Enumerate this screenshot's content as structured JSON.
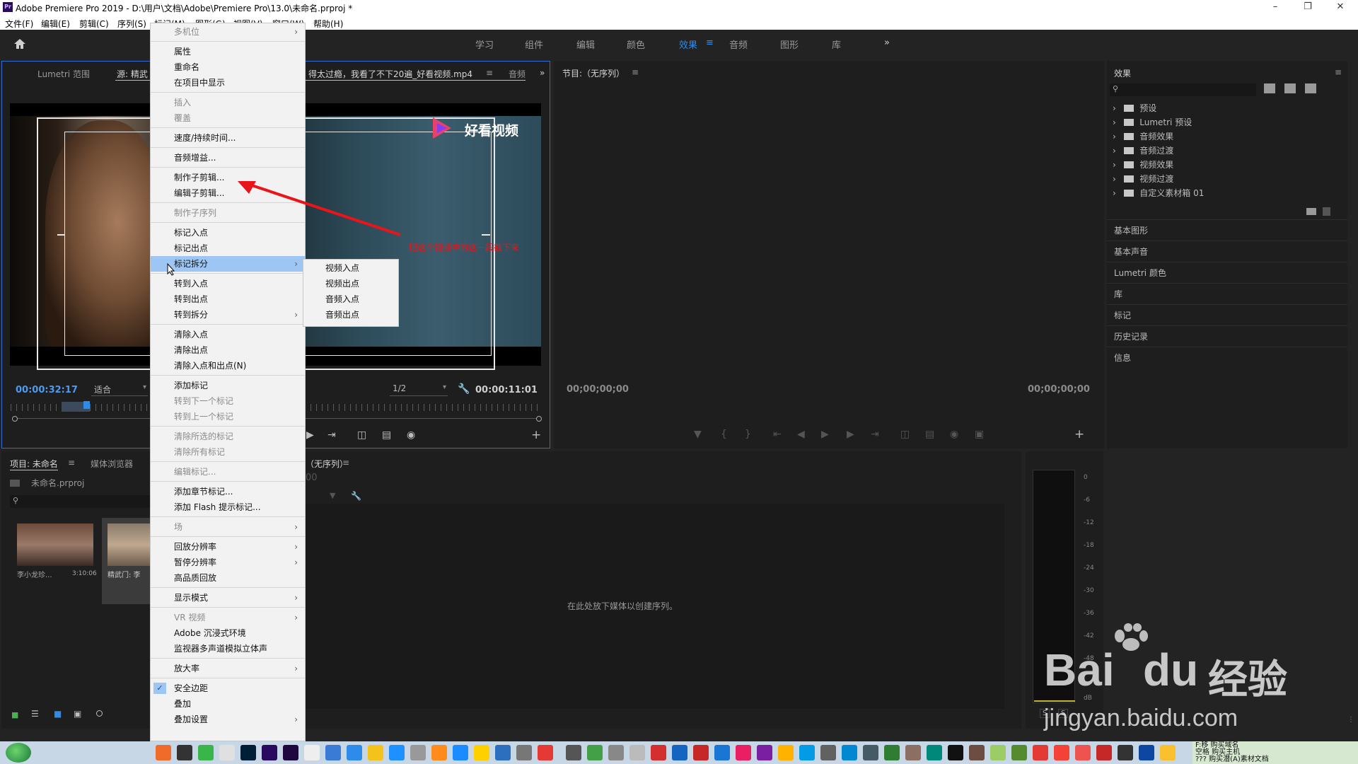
{
  "window": {
    "title": "Adobe Premiere Pro 2019 - D:\\用户\\文档\\Adobe\\Premiere Pro\\13.0\\未命名.prproj *",
    "app_icon": "Pr"
  },
  "menubar": [
    "文件(F)",
    "编辑(E)",
    "剪辑(C)",
    "序列(S)",
    "标记(M)",
    "图形(G)",
    "视图(V)",
    "窗口(W)",
    "帮助(H)"
  ],
  "workspaces": [
    {
      "label": "学习"
    },
    {
      "label": "组件"
    },
    {
      "label": "编辑"
    },
    {
      "label": "颜色"
    },
    {
      "label": "效果",
      "active": true
    },
    {
      "label": "音频"
    },
    {
      "label": "图形"
    },
    {
      "label": "库"
    }
  ],
  "source_panel": {
    "tabs": [
      "Lumetri 范围",
      "源: 精武",
      "得太过瘾，我看了不下20遍_好看视频.mp4",
      "音频"
    ],
    "watermark": "好看视频",
    "timecode": "00:00:32:17",
    "fit": "适合",
    "resolution": "1/2",
    "duration": "00:00:11:01"
  },
  "program_panel": {
    "title": "节目:（无序列）",
    "timecode_left": "00;00;00;00",
    "timecode_right": "00;00;00;00"
  },
  "effects_panel": {
    "title": "效果",
    "tree": [
      "预设",
      "Lumetri 预设",
      "音频效果",
      "音频过渡",
      "视频效果",
      "视频过渡",
      "自定义素材箱 01"
    ],
    "sections": [
      "基本图形",
      "基本声音",
      "Lumetri 颜色",
      "库",
      "标记",
      "历史记录",
      "信息"
    ]
  },
  "project_panel": {
    "tabs": [
      "项目: 未命名",
      "媒体浏览器"
    ],
    "file": "未命名.prproj",
    "clips": [
      {
        "name": "李小龙珍...",
        "duration": "3:10:06"
      },
      {
        "name": "精武门: 李",
        "duration": ""
      }
    ]
  },
  "timeline_panel": {
    "title": "（无序列）",
    "timecode": "00",
    "placeholder": "在此处放下媒体以创建序列。"
  },
  "audio_meter": {
    "scale": [
      "0",
      "-6",
      "-12",
      "-18",
      "-24",
      "-30",
      "-36",
      "-42",
      "-48",
      "dB"
    ],
    "buttons": [
      "S",
      "S"
    ]
  },
  "context_menu": {
    "items": [
      {
        "label": "多机位",
        "disabled": true,
        "submenu": true
      },
      {
        "sep": true
      },
      {
        "label": "属性"
      },
      {
        "label": "重命名"
      },
      {
        "label": "在项目中显示"
      },
      {
        "sep": true
      },
      {
        "label": "插入",
        "disabled": true
      },
      {
        "label": "覆盖",
        "disabled": true
      },
      {
        "sep": true
      },
      {
        "label": "速度/持续时间..."
      },
      {
        "sep": true
      },
      {
        "label": "音频增益..."
      },
      {
        "sep": true
      },
      {
        "label": "制作子剪辑..."
      },
      {
        "label": "编辑子剪辑..."
      },
      {
        "sep": true
      },
      {
        "label": "制作子序列",
        "disabled": true
      },
      {
        "sep": true
      },
      {
        "label": "标记入点"
      },
      {
        "label": "标记出点"
      },
      {
        "label": "标记拆分",
        "submenu": true,
        "selected": true
      },
      {
        "sep": true
      },
      {
        "label": "转到入点"
      },
      {
        "label": "转到出点"
      },
      {
        "label": "转到拆分",
        "submenu": true
      },
      {
        "sep": true
      },
      {
        "label": "清除入点"
      },
      {
        "label": "清除出点"
      },
      {
        "label": "清除入点和出点(N)"
      },
      {
        "sep": true
      },
      {
        "label": "添加标记"
      },
      {
        "label": "转到下一个标记",
        "disabled": true
      },
      {
        "label": "转到上一个标记",
        "disabled": true
      },
      {
        "sep": true
      },
      {
        "label": "清除所选的标记",
        "disabled": true
      },
      {
        "label": "清除所有标记",
        "disabled": true
      },
      {
        "sep": true
      },
      {
        "label": "编辑标记...",
        "disabled": true
      },
      {
        "sep": true
      },
      {
        "label": "添加章节标记..."
      },
      {
        "label": "添加 Flash 提示标记..."
      },
      {
        "sep": true
      },
      {
        "label": "场",
        "disabled": true,
        "submenu": true
      },
      {
        "sep": true
      },
      {
        "label": "回放分辨率",
        "submenu": true
      },
      {
        "label": "暂停分辨率",
        "submenu": true
      },
      {
        "label": "高品质回放"
      },
      {
        "sep": true
      },
      {
        "label": "显示模式",
        "submenu": true
      },
      {
        "sep": true
      },
      {
        "label": "VR 视频",
        "disabled": true,
        "submenu": true
      },
      {
        "label": "Adobe 沉浸式环境"
      },
      {
        "label": "监视器多声道模拟立体声"
      },
      {
        "sep": true
      },
      {
        "label": "放大率",
        "submenu": true
      },
      {
        "sep": true
      },
      {
        "label": "安全边距",
        "checked": true
      },
      {
        "label": "叠加"
      },
      {
        "label": "叠加设置",
        "submenu": true
      }
    ],
    "submenu": [
      "视频入点",
      "视频出点",
      "音频入点",
      "音频出点"
    ]
  },
  "annotation": {
    "text": "把这个视频中的这一段截下来",
    "color": "#e8151b"
  },
  "baidu_watermark": {
    "brand": "Bai",
    "brand2": "du",
    "cn": "经验",
    "url": "jingyan.baidu.com"
  },
  "taskbar": {
    "notification": [
      "F:移 购买域名",
      "空格 购买主机",
      "??? 购买潜(A)素材文档"
    ]
  },
  "colors": {
    "accent": "#2d8ceb",
    "panel_bg": "#1e1e1e",
    "app_bg": "#232323",
    "menu_selected": "#9ec6f5"
  }
}
